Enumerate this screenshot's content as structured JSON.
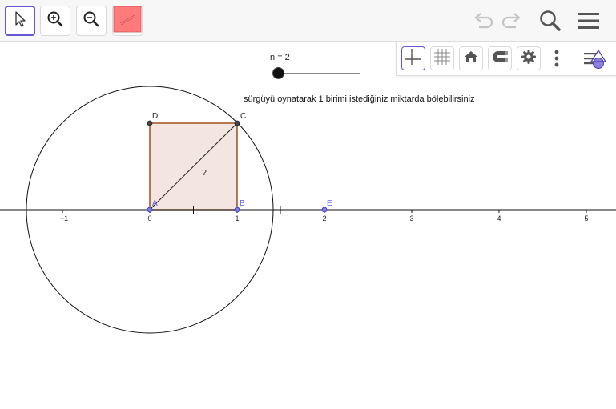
{
  "toolbar": {
    "tools": [
      "move-tool",
      "zoom-in-tool",
      "zoom-out-tool",
      "color-tool"
    ],
    "right_icons": [
      "undo-icon",
      "redo-icon",
      "search-icon",
      "menu-icon"
    ]
  },
  "style_bar": {
    "buttons": [
      "axes-icon",
      "grid-icon",
      "home-icon",
      "magnet-icon",
      "settings-icon",
      "more-icon",
      "algebra-view-icon"
    ]
  },
  "slider": {
    "label": "n = 2",
    "value": 2
  },
  "instruction": "sürgüyü oynatarak 1 birimi istediğiniz miktarda bölebilirsiniz",
  "graph": {
    "tick_labels": [
      "−1",
      "0",
      "1",
      "2",
      "3",
      "4",
      "5"
    ],
    "points": {
      "A": "A",
      "B": "B",
      "C": "C",
      "D": "D",
      "E": "E"
    },
    "question_mark": "?"
  },
  "colors": {
    "accent": "#6557d2",
    "square_stroke": "#993300",
    "square_fill": "#f3e6e0",
    "point_blue": "#5c5cdc",
    "color_swatch": "#ff7b7b"
  }
}
